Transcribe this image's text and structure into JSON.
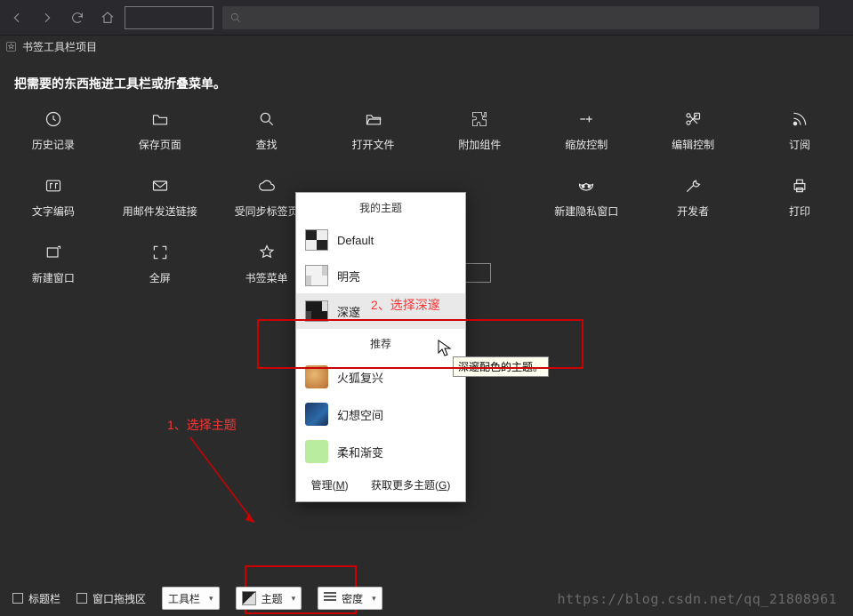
{
  "bookmark_bar": {
    "label": "书签工具栏项目"
  },
  "instruction": "把需要的东西拖进工具栏或折叠菜单。",
  "tools_row1": [
    {
      "label": "历史记录"
    },
    {
      "label": "保存页面"
    },
    {
      "label": "查找"
    },
    {
      "label": "打开文件"
    },
    {
      "label": "附加组件"
    },
    {
      "label": "缩放控制"
    },
    {
      "label": "编辑控制"
    },
    {
      "label": "订阅"
    }
  ],
  "tools_row2": [
    {
      "label": "文字编码"
    },
    {
      "label": "用邮件发送链接"
    },
    {
      "label": "受同步标签页"
    },
    {
      "label": ""
    },
    {
      "label": ""
    },
    {
      "label": "新建隐私窗口"
    },
    {
      "label": "开发者"
    },
    {
      "label": "打印"
    }
  ],
  "tools_row3": [
    {
      "label": "新建窗口"
    },
    {
      "label": "全屏"
    },
    {
      "label": "书签菜单"
    }
  ],
  "popup": {
    "header1": "我的主题",
    "items1": [
      {
        "label": "Default"
      },
      {
        "label": "明亮"
      },
      {
        "label": "深邃"
      }
    ],
    "header2": "推荐",
    "items2": [
      {
        "label": "火狐复兴"
      },
      {
        "label": "幻想空间"
      },
      {
        "label": "柔和渐变"
      }
    ],
    "manage": "管理(",
    "manage_u": "M",
    "manage_end": ")",
    "more": "获取更多主题(",
    "more_u": "G",
    "more_end": ")"
  },
  "tooltip": "深邃配色的主题。",
  "anno": {
    "step1": "1、选择主题",
    "step2": "2、选择深邃"
  },
  "bottom": {
    "chk1": "标题栏",
    "chk2": "窗口拖拽区",
    "dd1": "工具栏",
    "dd2": "主题",
    "dd3": "密度"
  },
  "watermark": "https://blog.csdn.net/qq_21808961"
}
